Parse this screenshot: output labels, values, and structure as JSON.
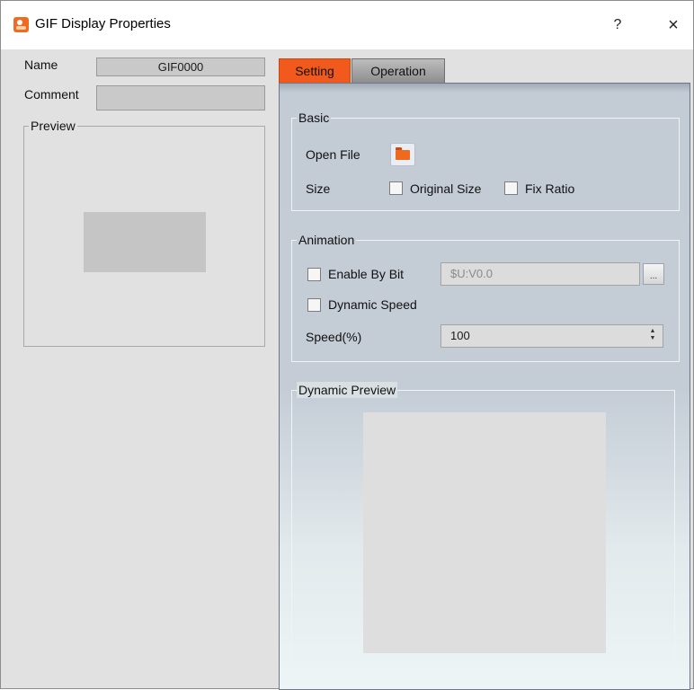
{
  "window": {
    "title": "GIF Display Properties",
    "help_label": "?",
    "close_label": "×"
  },
  "left": {
    "name_label": "Name",
    "name_value": "GIF0000",
    "comment_label": "Comment",
    "comment_value": "",
    "preview_title": "Preview"
  },
  "tabs": [
    {
      "label": "Setting",
      "active": true
    },
    {
      "label": "Operation",
      "active": false
    }
  ],
  "basic": {
    "title": "Basic",
    "open_file_label": "Open File",
    "size_label": "Size",
    "original_size_label": "Original Size",
    "original_size_checked": false,
    "fix_ratio_label": "Fix Ratio",
    "fix_ratio_checked": false
  },
  "animation": {
    "title": "Animation",
    "enable_by_bit_label": "Enable By Bit",
    "enable_by_bit_checked": false,
    "bit_address": "$U:V0.0",
    "browse_label": "...",
    "dynamic_speed_label": "Dynamic Speed",
    "dynamic_speed_checked": false,
    "speed_label": "Speed(%)",
    "speed_value": "100"
  },
  "dynamic_preview": {
    "title": "Dynamic Preview"
  },
  "colors": {
    "active_tab": "#f15a1c",
    "inactive_tab": "#8e8e8e",
    "panel": "#c4ccd6",
    "window_bg": "#e1e1e1"
  },
  "icons": {
    "app": "gif-app-icon",
    "open_file": "folder-icon"
  }
}
